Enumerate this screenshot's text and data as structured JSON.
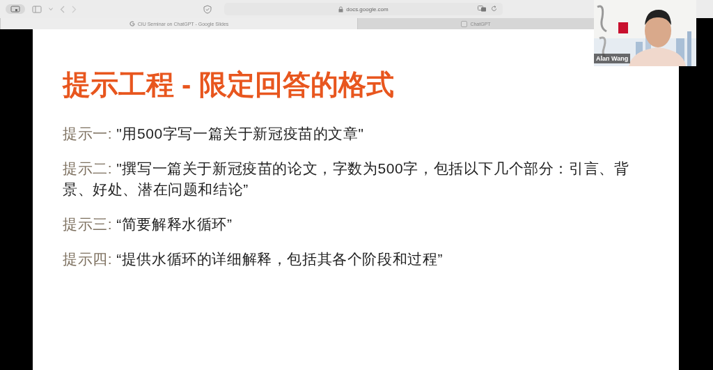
{
  "browser": {
    "address": "docs.google.com",
    "tabs": [
      {
        "label": "CIU Seminar on ChatGPT - Google Slides",
        "selected": true
      },
      {
        "label": "ChatGPT",
        "selected": false
      }
    ]
  },
  "slide": {
    "title": "提示工程 - 限定回答的格式",
    "prompts": [
      {
        "label": "提示一:",
        "text": "\"用500字写一篇关于新冠疫苗的文章\""
      },
      {
        "label": "提示二:",
        "text": "\"撰写一篇关于新冠疫苗的论文，字数为500字，包括以下几个部分：引言、背景、好处、潜在问题和结论”"
      },
      {
        "label": "提示三:",
        "text": "“简要解释水循环”"
      },
      {
        "label": "提示四:",
        "text": "“提供水循环的详细解释，包括其各个阶段和过程”"
      }
    ]
  },
  "video": {
    "kind": "picture",
    "name": "Alan Wang"
  }
}
